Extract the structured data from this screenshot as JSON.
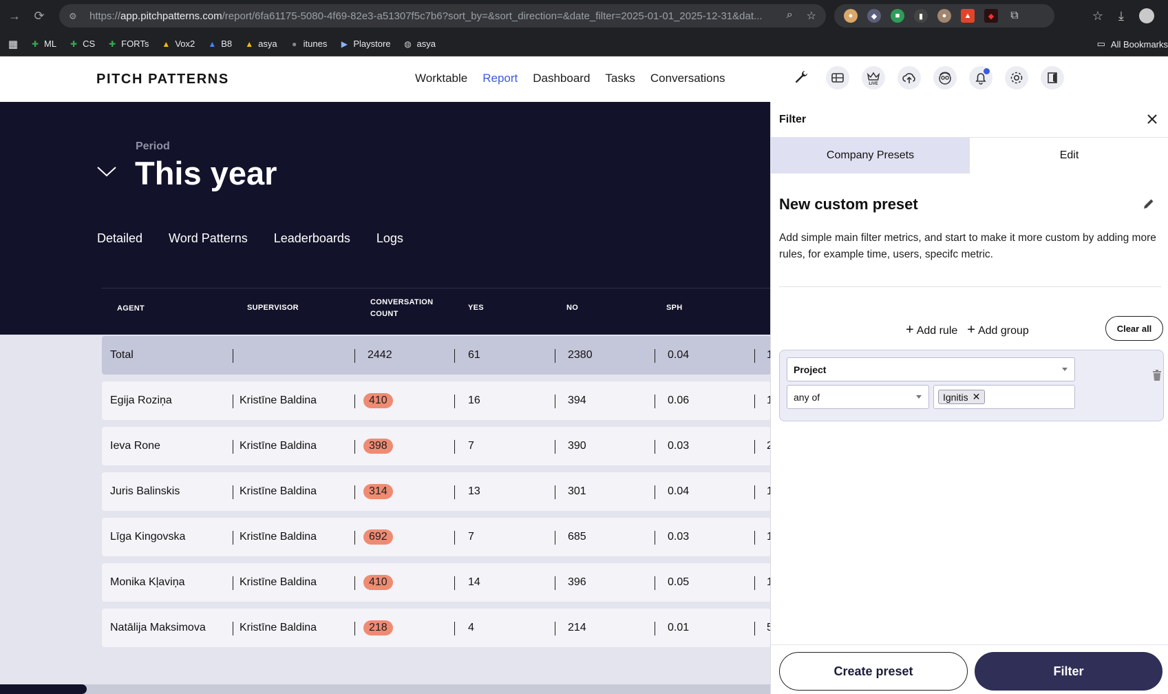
{
  "browser": {
    "url_prefix": "https://",
    "url_host": "app.pitchpatterns.com",
    "url_rest": "/report/6fa61175-5080-4f69-82e3-a51307f5c7b6?sort_by=&sort_direction=&date_filter=2025-01-01_2025-12-31&dat...",
    "bookmarks": [
      {
        "label": "ML"
      },
      {
        "label": "CS"
      },
      {
        "label": "FORTs"
      },
      {
        "label": "Vox2"
      },
      {
        "label": "B8"
      },
      {
        "label": "asya"
      },
      {
        "label": "itunes"
      },
      {
        "label": "Playstore"
      },
      {
        "label": "asya"
      }
    ],
    "all_bookmarks": "All Bookmarks"
  },
  "app": {
    "logo": "PITCH PATTERNS",
    "nav": [
      "Worktable",
      "Report",
      "Dashboard",
      "Tasks",
      "Conversations"
    ],
    "accent": "#3b5bdb"
  },
  "hero": {
    "period_label": "Period",
    "period_value": "This year",
    "tabs": [
      "Detailed",
      "Word Patterns",
      "Leaderboards",
      "Logs"
    ]
  },
  "table": {
    "headers": [
      "AGENT",
      "SUPERVISOR",
      "CONVERSATION",
      "COUNT",
      "YES",
      "NO",
      "SPH"
    ],
    "total": {
      "agent": "Total",
      "supervisor": "",
      "count": "2442",
      "yes": "61",
      "no": "2380",
      "sph": "0.04",
      "next": "1"
    },
    "rows": [
      {
        "agent": "Egija Roziņa",
        "supervisor": "Kristīne Baldina",
        "count": "410",
        "yes": "16",
        "no": "394",
        "sph": "0.06",
        "next": "1"
      },
      {
        "agent": "Ieva Rone",
        "supervisor": "Kristīne Baldina",
        "count": "398",
        "yes": "7",
        "no": "390",
        "sph": "0.03",
        "next": "2"
      },
      {
        "agent": "Juris Balinskis",
        "supervisor": "Kristīne Baldina",
        "count": "314",
        "yes": "13",
        "no": "301",
        "sph": "0.04",
        "next": "1"
      },
      {
        "agent": "Līga Kingovska",
        "supervisor": "Kristīne Baldina",
        "count": "692",
        "yes": "7",
        "no": "685",
        "sph": "0.03",
        "next": "1"
      },
      {
        "agent": "Monika Kļaviņa",
        "supervisor": "Kristīne Baldina",
        "count": "410",
        "yes": "14",
        "no": "396",
        "sph": "0.05",
        "next": "1"
      },
      {
        "agent": "Natālija Maksimova",
        "supervisor": "Kristīne Baldina",
        "count": "218",
        "yes": "4",
        "no": "214",
        "sph": "0.01",
        "next": "5"
      }
    ]
  },
  "filter": {
    "title": "Filter",
    "tabs": [
      "Company Presets",
      "Edit"
    ],
    "preset_title": "New custom preset",
    "preset_desc": "Add simple main filter metrics, and start to make it more custom by adding more rules, for example time, users, specifc metric.",
    "add_rule": "Add rule",
    "add_group": "Add group",
    "clear_all": "Clear all",
    "rule": {
      "field": "Project",
      "operator": "any of",
      "values": [
        "Ignitis"
      ]
    },
    "create_preset": "Create preset",
    "filter_button": "Filter"
  }
}
